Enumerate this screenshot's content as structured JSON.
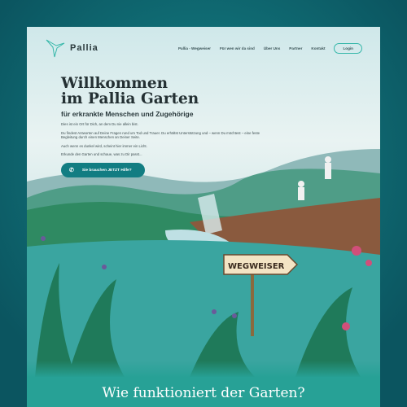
{
  "brand": {
    "name": "Pallia"
  },
  "nav": {
    "items": [
      "Pallia - Wegweiser",
      "Für wen wir da sind",
      "Über Uns",
      "Partner",
      "Kontakt"
    ],
    "login": "Login"
  },
  "hero": {
    "title_line1": "Willkommen",
    "title_line2": "im Pallia Garten",
    "subtitle": "für erkrankte Menschen und Zugehörige",
    "paragraphs": [
      "Dies ist ein Ort für Dich, an dem Du nie allein bist.",
      "Du findest Antworten auf Deine Fragen rund um Tod und Trauer. Du erhältst Unterstützung und – wenn Du möchtest – eine feste Begleitung durch einen Menschen an Deiner Seite.",
      "Auch wenn es dunkel wird, scheint hier immer ein Licht.",
      "Erkunde den Garten und schaue, was zu Dir passt..."
    ],
    "cta": "Sie brauchen JETZT Hilfe?"
  },
  "sign": "WEGWEISER",
  "section": {
    "heading": "Wie funktioniert der Garten?"
  },
  "colors": {
    "accent": "#127d82",
    "teal": "#27a196"
  }
}
